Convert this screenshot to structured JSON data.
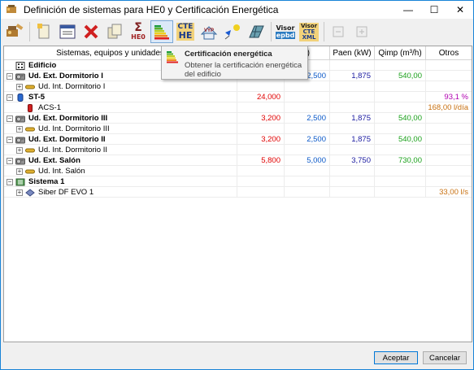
{
  "window": {
    "title": "Definición de sistemas para HE0 y Certificación Energética",
    "minimize": "—",
    "maximize": "☐",
    "close": "✕"
  },
  "toolbar": {
    "he0_label": "HE0",
    "sigma_label": "Σ",
    "cte_label": "CTE",
    "he_label": "HE",
    "vyp_label": "VYP",
    "visor_label": "Visor",
    "epbd_label": "epbd",
    "visor2_label": "Visor",
    "cte2_label": "CTE",
    "xml_label": "XML"
  },
  "tooltip": {
    "title": "Certificación energética",
    "description": "Obtener la certificación energética del edificio"
  },
  "columns": {
    "name": "Sistemas, equipos y unidades termi",
    "col2": "",
    "col3": "W)",
    "paen": "Paen (kW)",
    "qimp": "Qimp (m³/h)",
    "otros": "Otros"
  },
  "rows": [
    {
      "name": "Edificio",
      "level": 0,
      "bold": true,
      "icon": "building-icon",
      "expander": "",
      "c2": "",
      "c3": "",
      "c4": "",
      "c5": "",
      "c6": ""
    },
    {
      "name": "Ud. Ext. Dormitorio I",
      "level": 0,
      "bold": true,
      "icon": "outdoor-unit-icon",
      "expander": "−",
      "c2": "3,200",
      "c3": "2,500",
      "c4": "1,875",
      "c5": "540,00",
      "c6": ""
    },
    {
      "name": "Ud. Int. Dormitorio I",
      "level": 1,
      "bold": false,
      "icon": "indoor-unit-icon",
      "expander": "+",
      "c2": "",
      "c3": "",
      "c4": "",
      "c5": "",
      "c6": ""
    },
    {
      "name": "ST-5",
      "level": 0,
      "bold": true,
      "icon": "water-heater-icon",
      "expander": "−",
      "c2": "24,000",
      "c3": "",
      "c4": "",
      "c5": "",
      "c6": "93,1 %"
    },
    {
      "name": "ACS-1",
      "level": 1,
      "bold": false,
      "icon": "hot-water-icon",
      "expander": "",
      "c2": "",
      "c3": "",
      "c4": "",
      "c5": "",
      "c6": "168,00 l/día"
    },
    {
      "name": "Ud. Ext. Dormitorio III",
      "level": 0,
      "bold": true,
      "icon": "outdoor-unit-icon",
      "expander": "−",
      "c2": "3,200",
      "c3": "2,500",
      "c4": "1,875",
      "c5": "540,00",
      "c6": ""
    },
    {
      "name": "Ud. Int. Dormitorio III",
      "level": 1,
      "bold": false,
      "icon": "indoor-unit-icon",
      "expander": "+",
      "c2": "",
      "c3": "",
      "c4": "",
      "c5": "",
      "c6": ""
    },
    {
      "name": "Ud. Ext. Dormitorio II",
      "level": 0,
      "bold": true,
      "icon": "outdoor-unit-icon",
      "expander": "−",
      "c2": "3,200",
      "c3": "2,500",
      "c4": "1,875",
      "c5": "540,00",
      "c6": ""
    },
    {
      "name": "Ud. Int. Dormitorio II",
      "level": 1,
      "bold": false,
      "icon": "indoor-unit-icon",
      "expander": "+",
      "c2": "",
      "c3": "",
      "c4": "",
      "c5": "",
      "c6": ""
    },
    {
      "name": "Ud. Ext. Salón",
      "level": 0,
      "bold": true,
      "icon": "outdoor-unit-icon",
      "expander": "−",
      "c2": "5,800",
      "c3": "5,000",
      "c4": "3,750",
      "c5": "730,00",
      "c6": ""
    },
    {
      "name": "Ud. Int. Salón",
      "level": 1,
      "bold": false,
      "icon": "indoor-unit-icon",
      "expander": "+",
      "c2": "",
      "c3": "",
      "c4": "",
      "c5": "",
      "c6": ""
    },
    {
      "name": "Sistema 1",
      "level": 0,
      "bold": true,
      "icon": "ventilation-system-icon",
      "expander": "−",
      "c2": "",
      "c3": "",
      "c4": "",
      "c5": "",
      "c6": ""
    },
    {
      "name": "Siber DF EVO 1",
      "level": 1,
      "bold": false,
      "icon": "ventilation-unit-icon",
      "expander": "+",
      "c2": "",
      "c3": "",
      "c4": "",
      "c5": "",
      "c6": "33,00 l/s"
    }
  ],
  "colors": {
    "red": "#e00000",
    "blue": "#0a58c8",
    "navy": "#1a1aa0",
    "green": "#1aa01a",
    "purple": "#b000b0",
    "orange": "#c87010"
  },
  "footer": {
    "accept": "Aceptar",
    "cancel": "Cancelar"
  }
}
